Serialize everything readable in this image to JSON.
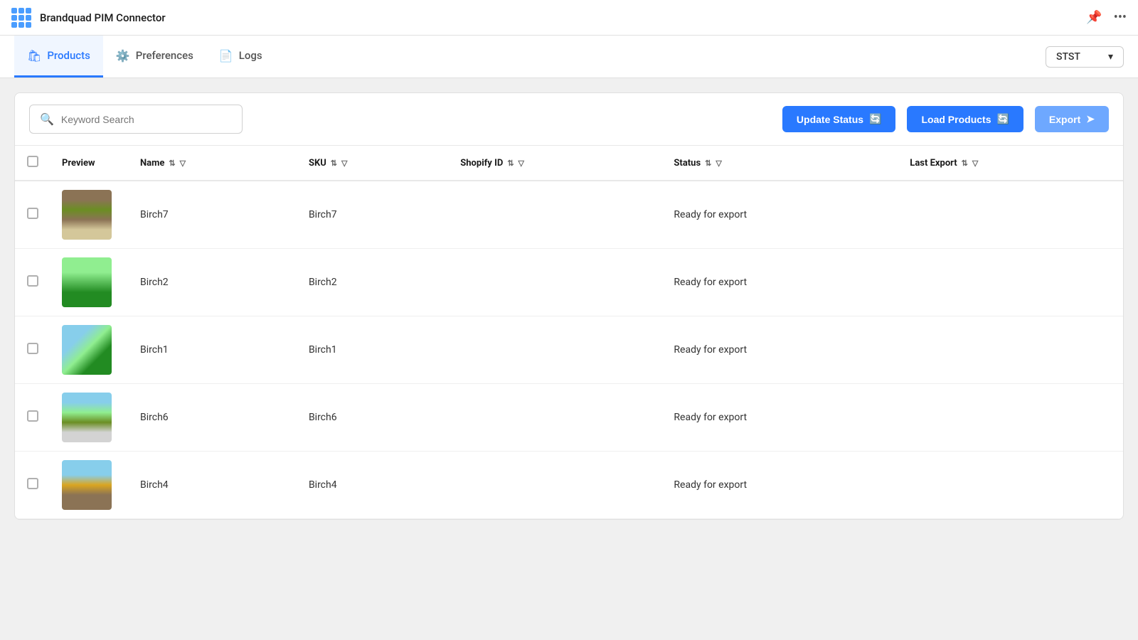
{
  "app": {
    "title": "Brandquad PIM Connector"
  },
  "nav": {
    "tabs": [
      {
        "id": "products",
        "label": "Products",
        "icon": "🛍",
        "active": true
      },
      {
        "id": "preferences",
        "label": "Preferences",
        "icon": "⚙",
        "active": false
      },
      {
        "id": "logs",
        "label": "Logs",
        "icon": "📄",
        "active": false
      }
    ],
    "store_selector": {
      "value": "STST",
      "label": "STST"
    }
  },
  "toolbar": {
    "search_placeholder": "Keyword Search",
    "update_status_label": "Update Status",
    "load_products_label": "Load Products",
    "export_label": "Export"
  },
  "table": {
    "columns": [
      {
        "id": "preview",
        "label": "Preview"
      },
      {
        "id": "name",
        "label": "Name",
        "sortable": true,
        "filterable": true
      },
      {
        "id": "sku",
        "label": "SKU",
        "sortable": true,
        "filterable": true
      },
      {
        "id": "shopify_id",
        "label": "Shopify ID",
        "sortable": true,
        "filterable": true
      },
      {
        "id": "status",
        "label": "Status",
        "sortable": true,
        "filterable": true
      },
      {
        "id": "last_export",
        "label": "Last Export",
        "sortable": true,
        "filterable": true
      }
    ],
    "rows": [
      {
        "id": 1,
        "name": "Birch7",
        "sku": "Birch7",
        "shopify_id": "",
        "status": "Ready for export",
        "last_export": "",
        "thumb_class": "thumb-birch7"
      },
      {
        "id": 2,
        "name": "Birch2",
        "sku": "Birch2",
        "shopify_id": "",
        "status": "Ready for export",
        "last_export": "",
        "thumb_class": "thumb-birch2"
      },
      {
        "id": 3,
        "name": "Birch1",
        "sku": "Birch1",
        "shopify_id": "",
        "status": "Ready for export",
        "last_export": "",
        "thumb_class": "thumb-birch1"
      },
      {
        "id": 4,
        "name": "Birch6",
        "sku": "Birch6",
        "shopify_id": "",
        "status": "Ready for export",
        "last_export": "",
        "thumb_class": "thumb-birch6"
      },
      {
        "id": 5,
        "name": "Birch4",
        "sku": "Birch4",
        "shopify_id": "",
        "status": "Ready for export",
        "last_export": "",
        "thumb_class": "thumb-birch4"
      }
    ]
  }
}
